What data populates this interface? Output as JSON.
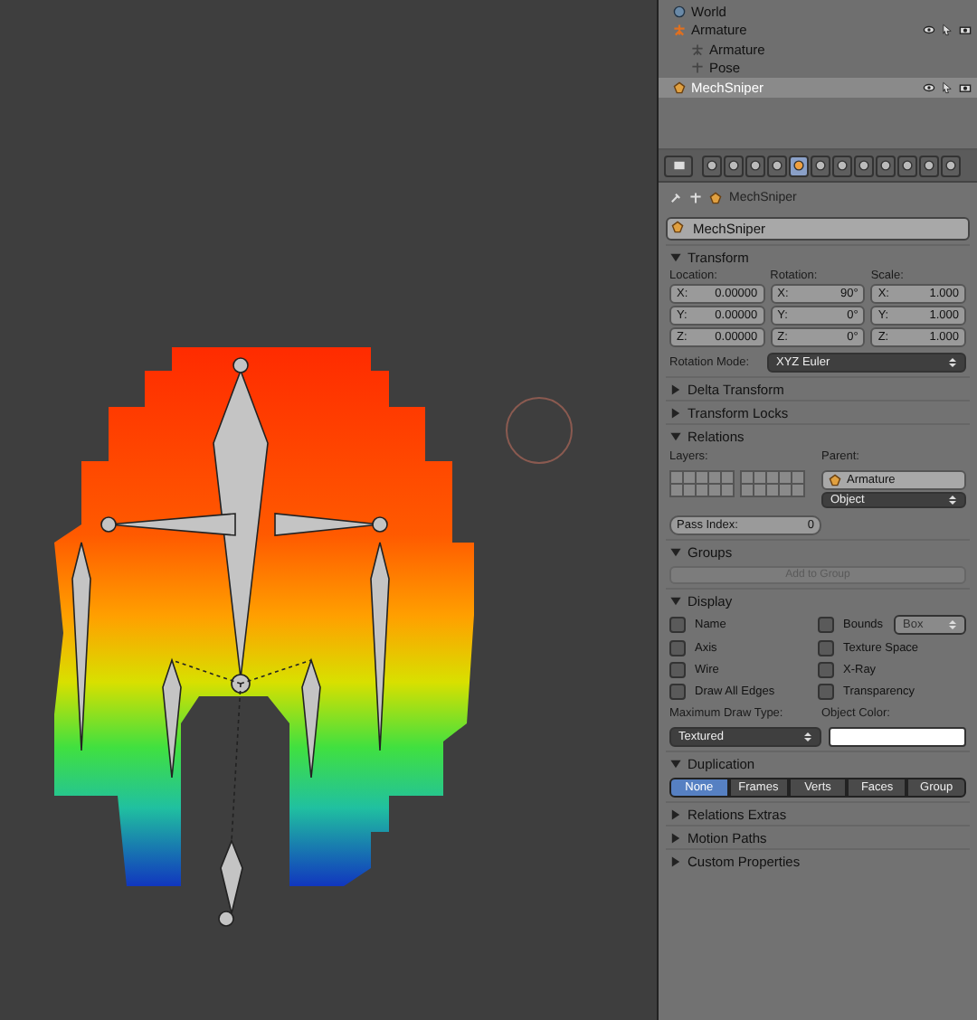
{
  "outliner": {
    "items": [
      {
        "name": "World",
        "kind": "world",
        "selected": false,
        "restrict": false
      },
      {
        "name": "Armature",
        "kind": "armature",
        "selected": false,
        "restrict": true,
        "children": [
          {
            "name": "Armature",
            "kind": "data",
            "selected": false,
            "restrict": false
          },
          {
            "name": "Pose",
            "kind": "pose",
            "selected": false,
            "restrict": false
          }
        ]
      },
      {
        "name": "MechSniper",
        "kind": "mesh",
        "selected": true,
        "restrict": true
      }
    ]
  },
  "context_tabs": [
    {
      "selected": false
    },
    {
      "selected": false
    },
    {
      "selected": false
    },
    {
      "selected": false
    },
    {
      "selected": true
    },
    {
      "selected": false
    },
    {
      "selected": false
    },
    {
      "selected": false
    },
    {
      "selected": false
    },
    {
      "selected": false
    },
    {
      "selected": false
    },
    {
      "selected": false
    }
  ],
  "breadcrumb": {
    "object": "MechSniper"
  },
  "object_name": "MechSniper",
  "panels": [
    {
      "kind": "transform",
      "title": "Transform",
      "expanded": true,
      "columns": [
        {
          "label": "Location:",
          "fields": [
            {
              "axis": "X:",
              "value": "0.00000"
            },
            {
              "axis": "Y:",
              "value": "0.00000"
            },
            {
              "axis": "Z:",
              "value": "0.00000"
            }
          ]
        },
        {
          "label": "Rotation:",
          "fields": [
            {
              "axis": "X:",
              "value": "90°"
            },
            {
              "axis": "Y:",
              "value": "0°"
            },
            {
              "axis": "Z:",
              "value": "0°"
            }
          ]
        },
        {
          "label": "Scale:",
          "fields": [
            {
              "axis": "X:",
              "value": "1.000"
            },
            {
              "axis": "Y:",
              "value": "1.000"
            },
            {
              "axis": "Z:",
              "value": "1.000"
            }
          ]
        }
      ],
      "mode_label": "Rotation Mode:",
      "mode": "XYZ Euler"
    },
    {
      "kind": "header",
      "title": "Delta Transform",
      "expanded": false
    },
    {
      "kind": "header",
      "title": "Transform Locks",
      "expanded": false
    },
    {
      "kind": "relations",
      "title": "Relations",
      "expanded": true,
      "layers_label": "Layers:",
      "parent_label": "Parent:",
      "parent": "Armature",
      "parent_type": "Object",
      "pass_label": "Pass Index:",
      "pass_value": "0"
    },
    {
      "kind": "groups",
      "title": "Groups",
      "expanded": true,
      "button": "Add to Group"
    },
    {
      "kind": "display",
      "title": "Display",
      "expanded": true,
      "checks": [
        {
          "label": "Name",
          "checked": false
        },
        {
          "label": "Bounds",
          "checked": false
        },
        {
          "label": "Axis",
          "checked": false
        },
        {
          "label": "Texture Space",
          "checked": false
        },
        {
          "label": "Wire",
          "checked": false
        },
        {
          "label": "X-Ray",
          "checked": false
        },
        {
          "label": "Draw All Edges",
          "checked": false
        },
        {
          "label": "Transparency",
          "checked": false
        }
      ],
      "bounds_type": "Box",
      "draw_type_label": "Maximum Draw Type:",
      "draw_type": "Textured",
      "color_label": "Object Color:",
      "color": "#ffffff"
    },
    {
      "kind": "duplication",
      "title": "Duplication",
      "expanded": true,
      "options": [
        {
          "label": "None",
          "selected": true
        },
        {
          "label": "Frames",
          "selected": false
        },
        {
          "label": "Verts",
          "selected": false
        },
        {
          "label": "Faces",
          "selected": false
        },
        {
          "label": "Group",
          "selected": false
        }
      ]
    },
    {
      "kind": "header",
      "title": "Relations Extras",
      "expanded": false
    },
    {
      "kind": "header",
      "title": "Motion Paths",
      "expanded": false
    },
    {
      "kind": "header",
      "title": "Custom Properties",
      "expanded": false
    }
  ]
}
